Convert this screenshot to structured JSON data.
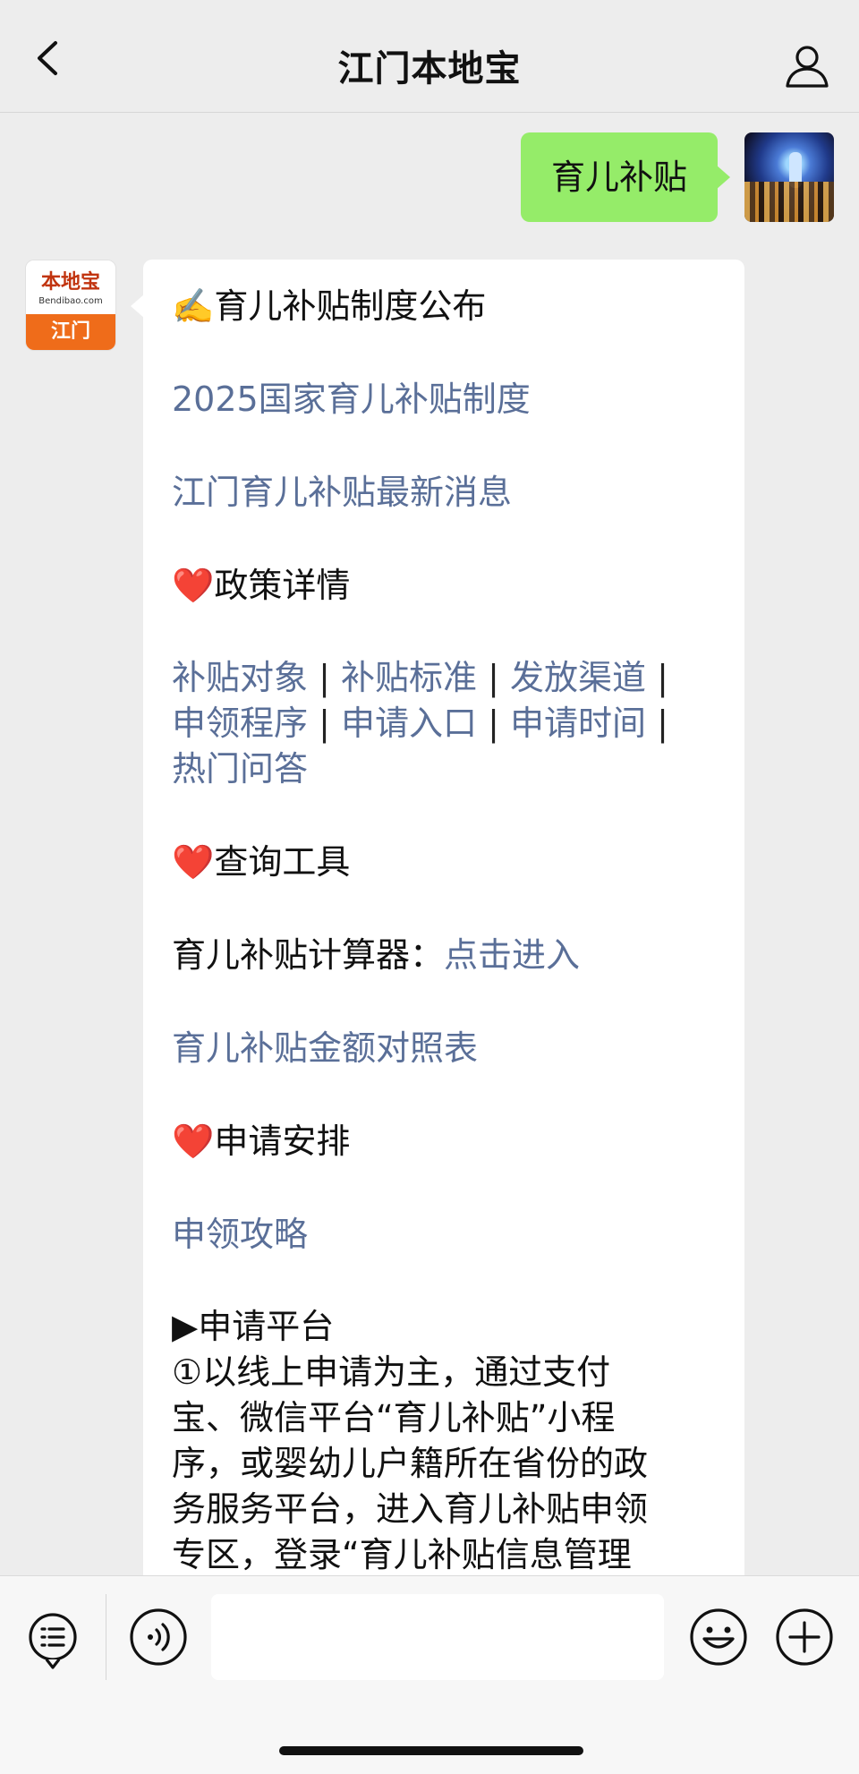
{
  "header": {
    "title": "江门本地宝",
    "back_icon": "chevron-left-icon",
    "profile_icon": "person-icon"
  },
  "sent_message": {
    "text": "育儿补贴",
    "bubble_color": "#95ec69"
  },
  "bot_avatar": {
    "logo_main": "本地宝",
    "logo_sub": "Bendibao.com",
    "logo_city": "江门",
    "accent_color": "#ef6c1a"
  },
  "message": {
    "heading": "✍️育儿补贴制度公布",
    "link1": "2025国家育儿补贴制度",
    "link2": "江门育儿补贴最新消息",
    "section1_heart": "❤️",
    "section1_title": "政策详情",
    "policy_links": [
      "补贴对象",
      "补贴标准",
      "发放渠道",
      "申领程序",
      "申请入口",
      "申请时间",
      "热门问答"
    ],
    "separator": "|",
    "section2_heart": "❤️",
    "section2_title": "查询工具",
    "calculator_label": "育儿补贴计算器：",
    "calculator_link": "点击进入",
    "amount_table_link": "育儿补贴金额对照表",
    "section3_heart": "❤️",
    "section3_title": "申请安排",
    "guide_link": "申领攻略",
    "platform_heading": "▶申请平台",
    "platform_text_lines": [
      "①以线上申请为主，通过支付",
      "宝、微信平台“育儿补贴”小程",
      "序，或婴幼儿户籍所在省份的政",
      "务服务平台，进入育儿补贴申领",
      "专区，登录“育儿补贴信息管理"
    ],
    "link_color": "#5a6f98"
  },
  "input_bar": {
    "menu_icon": "menu-list-icon",
    "voice_icon": "voice-icon",
    "emoji_icon": "emoji-icon",
    "plus_icon": "plus-circle-icon"
  }
}
